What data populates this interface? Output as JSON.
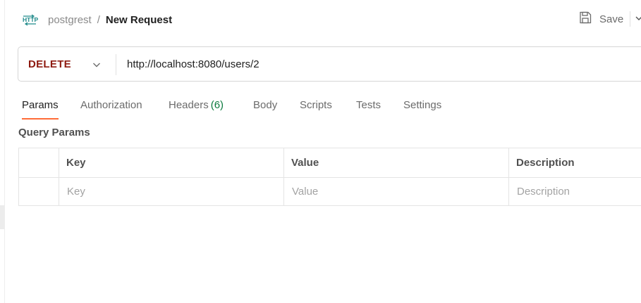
{
  "header": {
    "icon": "http-icon",
    "collection": "postgrest",
    "separator": "/",
    "request_name": "New Request",
    "save_label": "Save"
  },
  "request": {
    "method": "DELETE",
    "method_color": "#8e1a10",
    "url": "http://localhost:8080/users/2"
  },
  "tabs": [
    {
      "label": "Params",
      "active": true
    },
    {
      "label": "Authorization"
    },
    {
      "label": "Headers",
      "count": "(6)"
    },
    {
      "label": "Body"
    },
    {
      "label": "Scripts"
    },
    {
      "label": "Tests"
    },
    {
      "label": "Settings"
    }
  ],
  "accent_color": "#ff6c37",
  "query_params": {
    "title": "Query Params",
    "columns": [
      "Key",
      "Value",
      "Description"
    ],
    "placeholders": {
      "key": "Key",
      "value": "Value",
      "description": "Description"
    }
  }
}
